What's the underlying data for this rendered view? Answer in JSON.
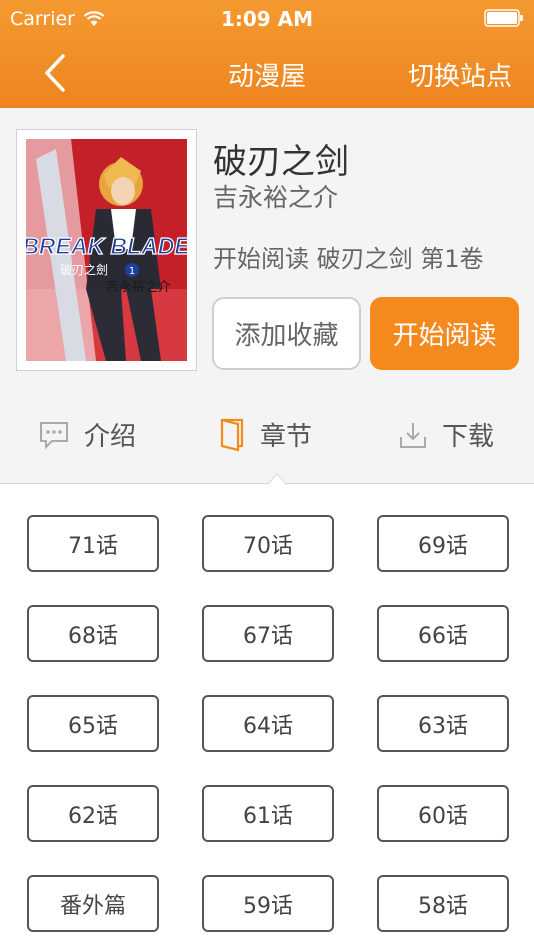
{
  "status_bar": {
    "carrier": "Carrier",
    "time": "1:09 AM"
  },
  "nav": {
    "title": "动漫屋",
    "right_action": "切换站点"
  },
  "book": {
    "title": "破刃之剑",
    "author": "吉永裕之介",
    "progress": "开始阅读 破刃之剑 第1卷",
    "cover_text": {
      "main": "BREAK BLADE",
      "sub": "破刃之劍",
      "volume": "1",
      "author": "吉永裕之介"
    }
  },
  "actions": {
    "favorite": "添加收藏",
    "start_reading": "开始阅读"
  },
  "tabs": {
    "intro": "介绍",
    "chapters": "章节",
    "download": "下载"
  },
  "chapters": [
    "71话",
    "70话",
    "69话",
    "68话",
    "67话",
    "66话",
    "65话",
    "64话",
    "63话",
    "62话",
    "61话",
    "60话",
    "番外篇",
    "59话",
    "58话"
  ],
  "colors": {
    "accent": "#f48a1e",
    "header": "#f29330"
  }
}
